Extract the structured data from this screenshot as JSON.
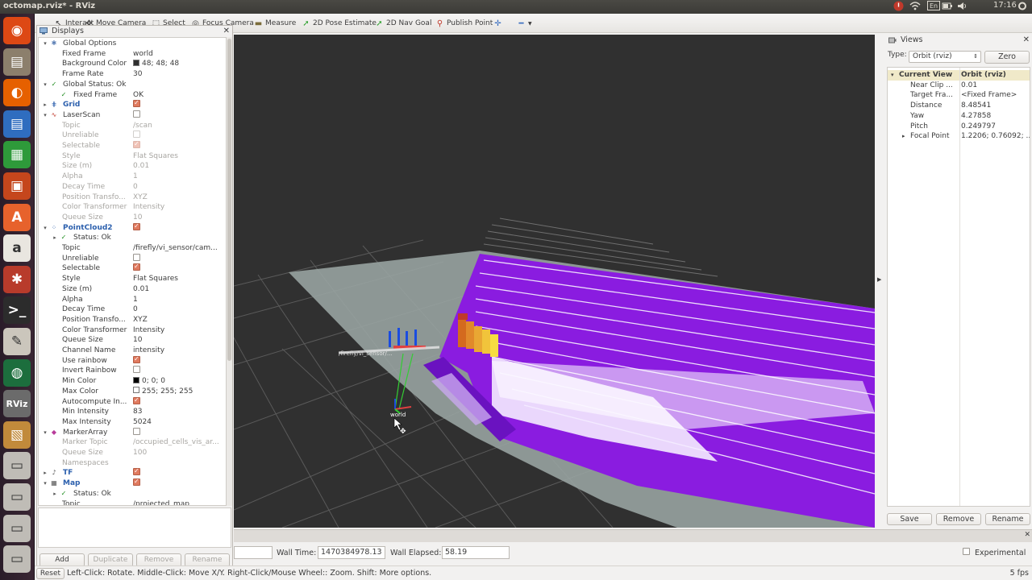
{
  "window": {
    "title": "octomap.rviz* - RViz"
  },
  "tray": {
    "lang": "En",
    "clock": "17:16"
  },
  "launcher": [
    {
      "icon": "ubuntu-dash-icon",
      "glyph": "◉",
      "bg": "#dd4814"
    },
    {
      "icon": "files-icon",
      "glyph": "▤",
      "bg": "#8c7f6c"
    },
    {
      "icon": "firefox-icon",
      "glyph": "◐",
      "bg": "#e66000"
    },
    {
      "icon": "writer-icon",
      "glyph": "▤",
      "bg": "#2f6dbf"
    },
    {
      "icon": "calc-icon",
      "glyph": "▦",
      "bg": "#2e9a3a"
    },
    {
      "icon": "impress-icon",
      "glyph": "▣",
      "bg": "#c5461c"
    },
    {
      "icon": "software-center-icon",
      "glyph": "A",
      "bg": "#e7622c"
    },
    {
      "icon": "amazon-icon",
      "glyph": "a",
      "bg": "#e9e6e0"
    },
    {
      "icon": "settings-icon",
      "glyph": "✱",
      "bg": "#b83b2b"
    },
    {
      "icon": "terminal-icon",
      "glyph": ">_",
      "bg": "#2c2c2c"
    },
    {
      "icon": "text-editor-icon",
      "glyph": "✎",
      "bg": "#cbc6bc"
    },
    {
      "icon": "globe-icon",
      "glyph": "◍",
      "bg": "#1c6e3d"
    },
    {
      "icon": "rviz-icon",
      "glyph": "RViz",
      "bg": "#6b6b6b"
    },
    {
      "icon": "box-icon",
      "glyph": "▧",
      "bg": "#c18a3b"
    },
    {
      "icon": "drive-icon",
      "glyph": "▭",
      "bg": "#bfbcb6"
    },
    {
      "icon": "drive-icon",
      "glyph": "▭",
      "bg": "#bfbcb6"
    },
    {
      "icon": "drive-icon",
      "glyph": "▭",
      "bg": "#bfbcb6"
    },
    {
      "icon": "drive-icon",
      "glyph": "▭",
      "bg": "#bfbcb6"
    }
  ],
  "toolbar": {
    "interact": "Interact",
    "move_camera": "Move Camera",
    "select": "Select",
    "focus_camera": "Focus Camera",
    "measure": "Measure",
    "pose_estimate": "2D Pose Estimate",
    "nav_goal": "2D Nav Goal",
    "publish_point": "Publish Point"
  },
  "displays": {
    "title": "Displays",
    "rows": [
      {
        "label": "Global Options",
        "depth": 0,
        "expand": "down",
        "icon": "✱",
        "iconColor": "#5b7fb5"
      },
      {
        "label": "Fixed Frame",
        "value": "world",
        "depth": 1
      },
      {
        "label": "Background Color",
        "value": "48; 48; 48",
        "swatch": "#303030",
        "depth": 1
      },
      {
        "label": "Frame Rate",
        "value": "30",
        "depth": 1
      },
      {
        "label": "Global Status: Ok",
        "depth": 0,
        "expand": "down",
        "icon": "✓",
        "iconColor": "#1a8a1a"
      },
      {
        "label": "Fixed Frame",
        "value": "OK",
        "depth": 1,
        "icon": "✓",
        "iconColor": "#1a8a1a"
      },
      {
        "label": "Grid",
        "depth": 0,
        "expand": "right",
        "icon": "⋕",
        "iconColor": "#2b5fad",
        "blue": true,
        "check": "on"
      },
      {
        "label": "LaserScan",
        "depth": 0,
        "expand": "down",
        "icon": "∿",
        "iconColor": "#c0392b",
        "check": "off"
      },
      {
        "label": "Topic",
        "value": "/scan",
        "depth": 1,
        "dis": true
      },
      {
        "label": "Unreliable",
        "depth": 1,
        "dis": true,
        "check": "dis"
      },
      {
        "label": "Selectable",
        "depth": 1,
        "dis": true,
        "check": "dis-on"
      },
      {
        "label": "Style",
        "value": "Flat Squares",
        "depth": 1,
        "dis": true
      },
      {
        "label": "Size (m)",
        "value": "0.01",
        "depth": 1,
        "dis": true
      },
      {
        "label": "Alpha",
        "value": "1",
        "depth": 1,
        "dis": true
      },
      {
        "label": "Decay Time",
        "value": "0",
        "depth": 1,
        "dis": true
      },
      {
        "label": "Position Transfo...",
        "value": "XYZ",
        "depth": 1,
        "dis": true
      },
      {
        "label": "Color Transformer",
        "value": "Intensity",
        "depth": 1,
        "dis": true
      },
      {
        "label": "Queue Size",
        "value": "10",
        "depth": 1,
        "dis": true
      },
      {
        "label": "PointCloud2",
        "depth": 0,
        "expand": "down",
        "icon": "⁘",
        "iconColor": "#2b5fad",
        "blue": true,
        "check": "on"
      },
      {
        "label": "Status: Ok",
        "depth": 1,
        "expand": "right",
        "icon": "✓",
        "iconColor": "#1a8a1a"
      },
      {
        "label": "Topic",
        "value": "/firefly/vi_sensor/cam...",
        "depth": 1
      },
      {
        "label": "Unreliable",
        "depth": 1,
        "check": "off"
      },
      {
        "label": "Selectable",
        "depth": 1,
        "check": "on"
      },
      {
        "label": "Style",
        "value": "Flat Squares",
        "depth": 1
      },
      {
        "label": "Size (m)",
        "value": "0.01",
        "depth": 1
      },
      {
        "label": "Alpha",
        "value": "1",
        "depth": 1
      },
      {
        "label": "Decay Time",
        "value": "0",
        "depth": 1
      },
      {
        "label": "Position Transfo...",
        "value": "XYZ",
        "depth": 1
      },
      {
        "label": "Color Transformer",
        "value": "Intensity",
        "depth": 1
      },
      {
        "label": "Queue Size",
        "value": "10",
        "depth": 1
      },
      {
        "label": "Channel Name",
        "value": "intensity",
        "depth": 1
      },
      {
        "label": "Use rainbow",
        "depth": 1,
        "check": "on"
      },
      {
        "label": "Invert Rainbow",
        "depth": 1,
        "check": "off"
      },
      {
        "label": "Min Color",
        "value": "0; 0; 0",
        "swatch": "#000000",
        "depth": 1
      },
      {
        "label": "Max Color",
        "value": "255; 255; 255",
        "swatch": "#ffffff",
        "depth": 1
      },
      {
        "label": "Autocompute In...",
        "depth": 1,
        "check": "on"
      },
      {
        "label": "Min Intensity",
        "value": "83",
        "depth": 1
      },
      {
        "label": "Max Intensity",
        "value": "5024",
        "depth": 1
      },
      {
        "label": "MarkerArray",
        "depth": 0,
        "expand": "down",
        "icon": "◆",
        "iconColor": "#b83b9a",
        "check": "off"
      },
      {
        "label": "Marker Topic",
        "value": "/occupied_cells_vis_ar...",
        "depth": 1,
        "dis": true
      },
      {
        "label": "Queue Size",
        "value": "100",
        "depth": 1,
        "dis": true
      },
      {
        "label": "Namespaces",
        "depth": 1,
        "dis": true
      },
      {
        "label": "TF",
        "depth": 0,
        "expand": "right",
        "icon": "♪",
        "iconColor": "#555",
        "blue": true,
        "check": "on"
      },
      {
        "label": "Map",
        "depth": 0,
        "expand": "down",
        "icon": "▦",
        "iconColor": "#555",
        "blue": true,
        "check": "on"
      },
      {
        "label": "Status: Ok",
        "depth": 1,
        "expand": "right",
        "icon": "✓",
        "iconColor": "#1a8a1a"
      },
      {
        "label": "Topic",
        "value": "/projected_map",
        "depth": 1
      }
    ],
    "buttons": {
      "add": "Add",
      "duplicate": "Duplicate",
      "remove": "Remove",
      "rename": "Rename"
    }
  },
  "scene": {
    "frame_label": "world",
    "laser_label": "/firefly/vi_sensor/...",
    "colors": {
      "purple": "#8a1ce0",
      "grey": "#9aa5a3",
      "bg": "#303030"
    }
  },
  "views": {
    "title": "Views",
    "type_label": "Type:",
    "type_value": "Orbit (rviz)",
    "zero": "Zero",
    "rows": [
      {
        "label": "Current View",
        "value": "Orbit (rviz)",
        "header": true
      },
      {
        "label": "Near Clip ...",
        "value": "0.01"
      },
      {
        "label": "Target Fra...",
        "value": "<Fixed Frame>"
      },
      {
        "label": "Distance",
        "value": "8.48541"
      },
      {
        "label": "Yaw",
        "value": "4.27858"
      },
      {
        "label": "Pitch",
        "value": "0.249797"
      },
      {
        "label": "Focal Point",
        "value": "1.2206; 0.76092; ...",
        "expand": true
      }
    ],
    "buttons": {
      "save": "Save",
      "remove": "Remove",
      "rename": "Rename"
    }
  },
  "time": {
    "wall_time_label": "Wall Time:",
    "wall_time": "1470384978.13",
    "wall_elapsed_label": "Wall Elapsed:",
    "wall_elapsed": "58.19",
    "experimental": "Experimental"
  },
  "status": {
    "reset": "Reset",
    "help": "Left-Click: Rotate. Middle-Click: Move X/Y. Right-Click/Mouse Wheel:: Zoom. Shift: More options.",
    "fps": "5 fps"
  }
}
